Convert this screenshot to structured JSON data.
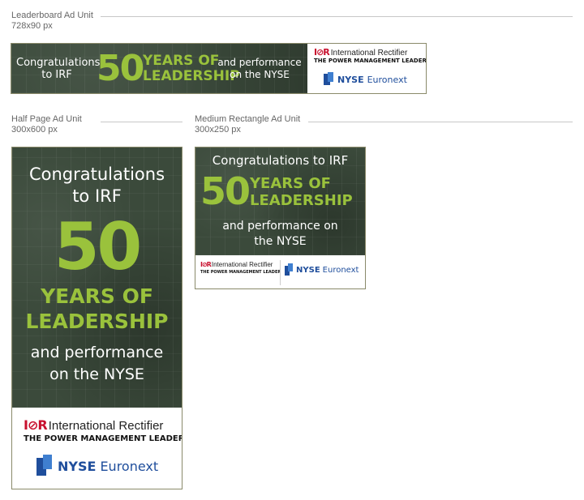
{
  "leaderboard": {
    "label": "Leaderboard Ad Unit",
    "dims": "728x90 px",
    "congrats_line1": "Congratulations",
    "congrats_line2": "to IRF",
    "fifty": "50",
    "years_of": "YEARS OF",
    "leadership": "LEADERSHIP",
    "perf_line1": "and performance",
    "perf_line2": "on the NYSE"
  },
  "half_page": {
    "label": "Half Page Ad Unit",
    "dims": "300x600 px",
    "congrats_line1": "Congratulations",
    "congrats_line2": "to IRF",
    "fifty": "50",
    "years_of": "YEARS OF",
    "leadership": "LEADERSHIP",
    "perf_line1": "and performance",
    "perf_line2": "on the NYSE"
  },
  "medium_rect": {
    "label": "Medium Rectangle Ad Unit",
    "dims": "300x250 px",
    "congrats": "Congratulations to IRF",
    "fifty": "50",
    "years_of": "YEARS OF",
    "leadership": "LEADERSHIP",
    "perf_line1": "and performance on",
    "perf_line2": "the NYSE"
  },
  "logos": {
    "ir_mark": "I⊘R",
    "ir_name": "International Rectifier",
    "ir_tagline": "THE POWER MANAGEMENT LEADER",
    "nyse": "NYSE",
    "euronext": "Euronext"
  },
  "colors": {
    "background": "#3b4a3b",
    "green": "#9ac23c",
    "ir_red": "#c8102e",
    "nyse_blue": "#1f4e9c"
  }
}
